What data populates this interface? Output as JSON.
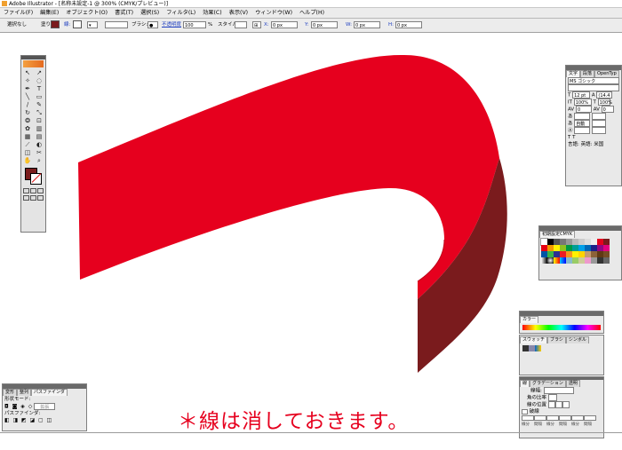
{
  "window": {
    "title": "Adobe Illustrator - [名称未設定-1 @ 300% (CMYK/プレビュー)]"
  },
  "menu": [
    "ファイル(F)",
    "編集(E)",
    "オブジェクト(O)",
    "書式(T)",
    "選択(S)",
    "フィルタ(L)",
    "効果(C)",
    "表示(V)",
    "ウィンドウ(W)",
    "ヘルプ(H)"
  ],
  "control": {
    "selection": "選択なし",
    "fill_label": "塗り:",
    "stroke_label": "線:",
    "brush_label": "ブラシ:",
    "opacity_label": "不透明度",
    "opacity_value": "100",
    "opacity_unit": "%",
    "style_label": "スタイル:",
    "x_label": "X:",
    "x_value": "0 px",
    "y_label": "Y:",
    "y_value": "0 px",
    "w_label": "W:",
    "w_value": "0 px",
    "h_label": "H:",
    "h_value": "0 px"
  },
  "char_panel": {
    "tabs": [
      "文字",
      "段落",
      "OpenTyp"
    ],
    "font": "MS ゴシック",
    "size": "12 pt",
    "leading": "(14.4",
    "hscale": "100%",
    "vscale": "100%",
    "tracking": "0",
    "kerning": "0",
    "auto": "自動",
    "lang": "言語: 英語: 米国"
  },
  "swatch_lib_panel": {
    "title": "初期設定CMYK"
  },
  "color_panel": {
    "tabs": [
      "カラー"
    ]
  },
  "swatches_panel": {
    "tabs": [
      "スウォッチ",
      "ブラシ",
      "シンボル"
    ]
  },
  "stroke_panel": {
    "tabs": [
      "線",
      "グラデーション",
      "透明"
    ],
    "weight_label": "線幅:",
    "cap_label": "角の比率",
    "limit_label": "線の位置",
    "dashed_label": "破線",
    "dash_labels": [
      "線分",
      "間隔",
      "線分",
      "間隔",
      "線分",
      "間隔"
    ]
  },
  "pathfinder_panel": {
    "tabs": [
      "変形",
      "整列",
      "パスファインダ"
    ],
    "shape_modes": "形状モード:",
    "expand": "拡張",
    "pathfinders": "パスファインダ:"
  },
  "note": "＊線は消しておきます。",
  "colors": {
    "ribbon_front": "#e6001e",
    "ribbon_side": "#7a1b1d",
    "note": "#e6001e"
  }
}
